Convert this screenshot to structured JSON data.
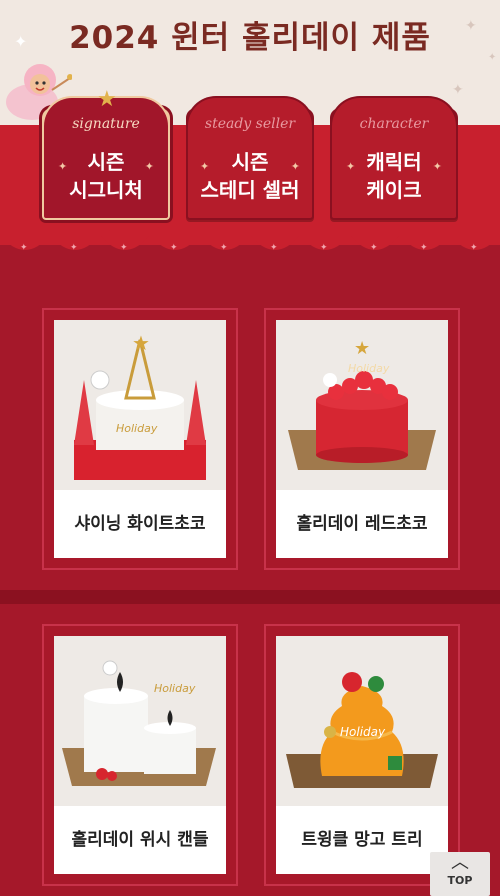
{
  "title": "2024 윈터 홀리데이 제품",
  "tabs": [
    {
      "sub": "signature",
      "label_line1": "시즌",
      "label_line2": "시그니처",
      "active": true
    },
    {
      "sub": "steady seller",
      "label_line1": "시즌",
      "label_line2": "스테디 셀러",
      "active": false
    },
    {
      "sub": "character",
      "label_line1": "캐릭터",
      "label_line2": "케이크",
      "active": false
    }
  ],
  "products": [
    {
      "name": "샤이닝 화이트초코",
      "icon": "cake-image"
    },
    {
      "name": "홀리데이 레드초코",
      "icon": "cake-image"
    },
    {
      "name": "홀리데이 위시 캔들",
      "icon": "cake-image"
    },
    {
      "name": "트윙클 망고 트리",
      "icon": "cake-image"
    }
  ],
  "top_button": {
    "label": "TOP"
  },
  "colors": {
    "accent": "#a5182a",
    "awning": "#c8202e",
    "title": "#7a2a22"
  }
}
